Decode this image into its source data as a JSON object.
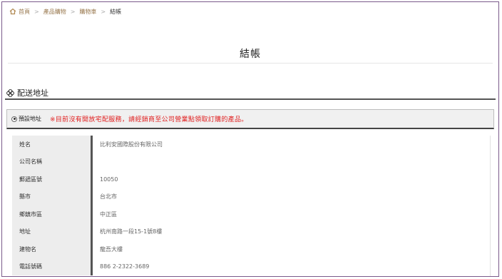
{
  "breadcrumb": {
    "items": [
      "首頁",
      "產品購物",
      "購物車"
    ],
    "current": "結帳"
  },
  "page": {
    "title": "結帳"
  },
  "section": {
    "title": "配送地址"
  },
  "notice": {
    "radio_label": "預設地址",
    "radio_selected": true,
    "warning": "※目前沒有開放宅配服務，請經銷商至公司營業點領取訂購的產品。"
  },
  "address": [
    {
      "label": "姓名",
      "value": "比利安國際股份有限公司"
    },
    {
      "label": "公司名稱",
      "value": ""
    },
    {
      "label": "郵遞區號",
      "value": "10050"
    },
    {
      "label": "縣市",
      "value": "台北市"
    },
    {
      "label": "鄉鎮市區",
      "value": "中正區"
    },
    {
      "label": "地址",
      "value": "杭州南路一段15-1號8樓"
    },
    {
      "label": "建物名",
      "value": "龍吾大樓"
    },
    {
      "label": "電話號碼",
      "value": "886 2-2322-3689"
    }
  ],
  "colors": {
    "warning": "#e02020",
    "breadcrumb_link": "#9a7a50",
    "frame_border": "#7a5a8a"
  }
}
